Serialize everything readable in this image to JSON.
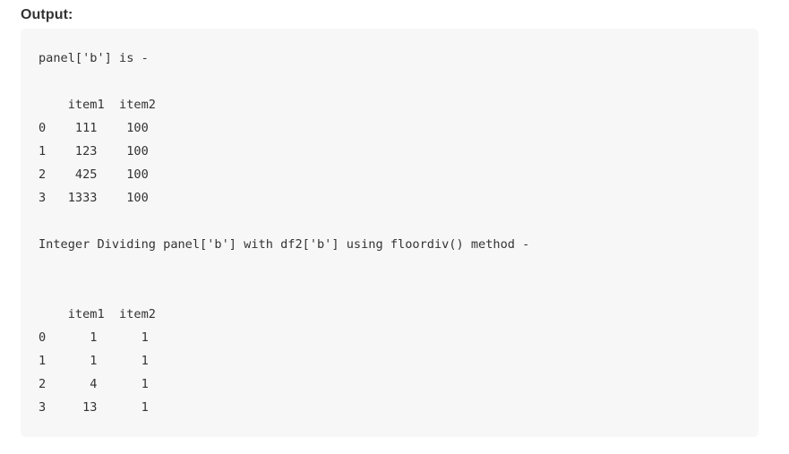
{
  "heading": "Output:",
  "output": {
    "lines": [
      "panel['b'] is -",
      "",
      "    item1  item2",
      "0    111    100",
      "1    123    100",
      "2    425    100",
      "3   1333    100",
      "",
      "Integer Dividing panel['b'] with df2['b'] using floordiv() method -",
      "",
      "",
      "    item1  item2",
      "0      1      1",
      "1      1      1",
      "2      4      1",
      "3     13      1"
    ]
  }
}
